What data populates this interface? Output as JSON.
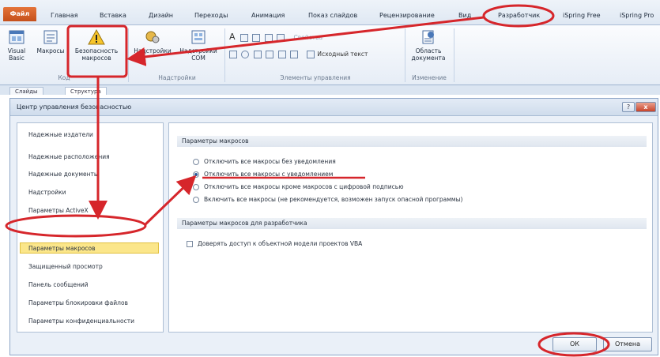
{
  "ribbon_tabs": {
    "file": "Файл",
    "home": "Главная",
    "insert": "Вставка",
    "design": "Дизайн",
    "transitions": "Переходы",
    "animation": "Анимация",
    "slideshow": "Показ слайдов",
    "review": "Рецензирование",
    "view": "Вид",
    "developer": "Разработчик",
    "ispring_free": "iSpring Free",
    "ispring_pro": "iSpring Pro"
  },
  "ribbon": {
    "vb": "Visual Basic",
    "macros": "Макросы",
    "macro_security": "Безопасность макросов",
    "addins": "Надстройки",
    "com_addins": "Надстройки COM",
    "group_code": "Код",
    "group_addins": "Надстройки",
    "properties": "Свойства",
    "view_code": "Исходный текст",
    "group_controls": "Элементы управления",
    "doc_panel": "Область документа",
    "group_modify": "Изменение"
  },
  "back_tabs": [
    "Слайды",
    "Структура"
  ],
  "dialog": {
    "title": "Центр управления безопасностью",
    "help": "?",
    "close": "x",
    "nav": [
      "Надежные издатели",
      "Надежные расположения",
      "Надежные документы",
      "Надстройки",
      "Параметры ActiveX",
      "Параметры макросов",
      "Защищенный просмотр",
      "Панель сообщений",
      "Параметры блокировки файлов",
      "Параметры конфиденциальности"
    ],
    "macro_section": "Параметры макросов",
    "options": [
      "Отключить все макросы без уведомления",
      "Отключить все макросы с уведомлением",
      "Отключить все макросы кроме макросов с цифровой подписью",
      "Включить все макросы (не рекомендуется, возможен запуск опасной программы)"
    ],
    "selected_option": 1,
    "dev_section": "Параметры макросов для разработчика",
    "vba_access": "Доверять доступ к объектной модели проектов VBA",
    "vba_access_checked": false,
    "ok": "ОК",
    "cancel": "Отмена"
  },
  "colors": {
    "annotation": "#d6262b",
    "highlight": "#fbe68a",
    "accent_file_tab": "#c5501b"
  }
}
